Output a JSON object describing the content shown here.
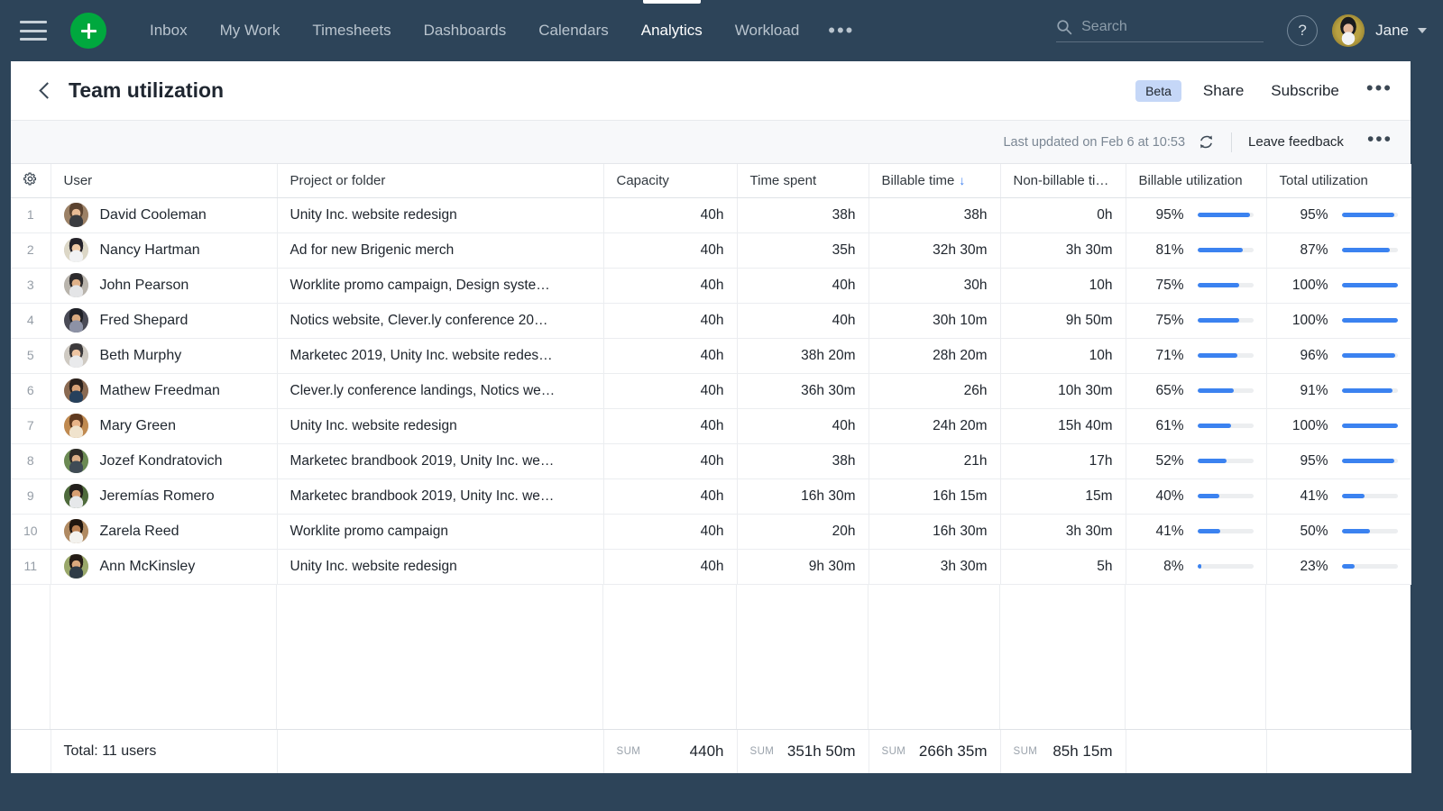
{
  "topnav": {
    "menu_icon": "hamburger-icon",
    "create_icon": "plus-icon",
    "links": [
      {
        "label": "Inbox",
        "active": false
      },
      {
        "label": "My Work",
        "active": false
      },
      {
        "label": "Timesheets",
        "active": false
      },
      {
        "label": "Dashboards",
        "active": false
      },
      {
        "label": "Calendars",
        "active": false
      },
      {
        "label": "Analytics",
        "active": true
      },
      {
        "label": "Workload",
        "active": false
      }
    ],
    "overflow": "•••",
    "search": {
      "placeholder": "Search",
      "value": "",
      "icon": "search-icon"
    },
    "help_label": "?",
    "user_name": "Jane"
  },
  "header": {
    "back_icon": "chevron-left-icon",
    "title": "Team utilization",
    "beta_label": "Beta",
    "share_label": "Share",
    "subscribe_label": "Subscribe",
    "more_label": "•••"
  },
  "subbar": {
    "last_updated": "Last updated on Feb 6 at 10:53",
    "refresh_icon": "refresh-icon",
    "feedback_label": "Leave feedback",
    "more_label": "•••"
  },
  "table": {
    "settings_icon": "gear-icon",
    "columns": [
      {
        "key": "user",
        "label": "User",
        "align": "left"
      },
      {
        "key": "project",
        "label": "Project or folder",
        "align": "left"
      },
      {
        "key": "capacity",
        "label": "Capacity",
        "align": "left"
      },
      {
        "key": "time_spent",
        "label": "Time spent",
        "align": "left"
      },
      {
        "key": "billable_time",
        "label": "Billable time",
        "align": "left",
        "sorted": "desc"
      },
      {
        "key": "non_billable_time",
        "label": "Non-billable time",
        "align": "left"
      },
      {
        "key": "billable_utilization",
        "label": "Billable utilization",
        "align": "left"
      },
      {
        "key": "total_utilization",
        "label": "Total utilization",
        "align": "left"
      }
    ],
    "sort_arrow": "↓",
    "rows": [
      {
        "idx": "1",
        "user": "David Cooleman",
        "project": "Unity Inc. website redesign",
        "capacity": "40h",
        "time_spent": "38h",
        "billable_time": "38h",
        "non_billable_time": "0h",
        "billable_utilization": "95%",
        "billable_pct": 95,
        "total_utilization": "95%",
        "total_pct": 95
      },
      {
        "idx": "2",
        "user": "Nancy Hartman",
        "project": "Ad for new Brigenic merch",
        "capacity": "40h",
        "time_spent": "35h",
        "billable_time": "32h 30m",
        "non_billable_time": "3h 30m",
        "billable_utilization": "81%",
        "billable_pct": 81,
        "total_utilization": "87%",
        "total_pct": 87
      },
      {
        "idx": "3",
        "user": "John Pearson",
        "project": "Worklite promo campaign, Design syste…",
        "capacity": "40h",
        "time_spent": "40h",
        "billable_time": "30h",
        "non_billable_time": "10h",
        "billable_utilization": "75%",
        "billable_pct": 75,
        "total_utilization": "100%",
        "total_pct": 100
      },
      {
        "idx": "4",
        "user": "Fred Shepard",
        "project": "Notics website, Clever.ly conference 20…",
        "capacity": "40h",
        "time_spent": "40h",
        "billable_time": "30h 10m",
        "non_billable_time": "9h 50m",
        "billable_utilization": "75%",
        "billable_pct": 75,
        "total_utilization": "100%",
        "total_pct": 100
      },
      {
        "idx": "5",
        "user": "Beth Murphy",
        "project": "Marketec 2019, Unity Inc. website redes…",
        "capacity": "40h",
        "time_spent": "38h 20m",
        "billable_time": "28h 20m",
        "non_billable_time": "10h",
        "billable_utilization": "71%",
        "billable_pct": 71,
        "total_utilization": "96%",
        "total_pct": 96
      },
      {
        "idx": "6",
        "user": "Mathew Freedman",
        "project": "Clever.ly conference landings, Notics we…",
        "capacity": "40h",
        "time_spent": "36h 30m",
        "billable_time": "26h",
        "non_billable_time": "10h 30m",
        "billable_utilization": "65%",
        "billable_pct": 65,
        "total_utilization": "91%",
        "total_pct": 91
      },
      {
        "idx": "7",
        "user": "Mary Green",
        "project": "Unity Inc. website redesign",
        "capacity": "40h",
        "time_spent": "40h",
        "billable_time": "24h 20m",
        "non_billable_time": "15h 40m",
        "billable_utilization": "61%",
        "billable_pct": 61,
        "total_utilization": "100%",
        "total_pct": 100
      },
      {
        "idx": "8",
        "user": "Jozef Kondratovich",
        "project": "Marketec brandbook 2019, Unity Inc. we…",
        "capacity": "40h",
        "time_spent": "38h",
        "billable_time": "21h",
        "non_billable_time": "17h",
        "billable_utilization": "52%",
        "billable_pct": 52,
        "total_utilization": "95%",
        "total_pct": 95
      },
      {
        "idx": "9",
        "user": "Jeremías Romero",
        "project": "Marketec brandbook 2019, Unity Inc. we…",
        "capacity": "40h",
        "time_spent": "16h 30m",
        "billable_time": "16h 15m",
        "non_billable_time": "15m",
        "billable_utilization": "40%",
        "billable_pct": 40,
        "total_utilization": "41%",
        "total_pct": 41
      },
      {
        "idx": "10",
        "user": "Zarela Reed",
        "project": "Worklite promo campaign",
        "capacity": "40h",
        "time_spent": "20h",
        "billable_time": "16h 30m",
        "non_billable_time": "3h 30m",
        "billable_utilization": "41%",
        "billable_pct": 41,
        "total_utilization": "50%",
        "total_pct": 50
      },
      {
        "idx": "11",
        "user": "Ann McKinsley",
        "project": "Unity Inc. website redesign",
        "capacity": "40h",
        "time_spent": "9h 30m",
        "billable_time": "3h 30m",
        "non_billable_time": "5h",
        "billable_utilization": "8%",
        "billable_pct": 8,
        "total_utilization": "23%",
        "total_pct": 23
      }
    ],
    "footer": {
      "total_label": "Total: 11 users",
      "sum_label": "SUM",
      "capacity_sum": "440h",
      "time_spent_sum": "351h 50m",
      "billable_sum": "266h 35m",
      "non_billable_sum": "85h 15m"
    }
  },
  "colors": {
    "nav_bg": "#2d4459",
    "accent_blue": "#3b82f0",
    "create_green": "#00a83e",
    "beta_badge": "#c5d7f7"
  }
}
